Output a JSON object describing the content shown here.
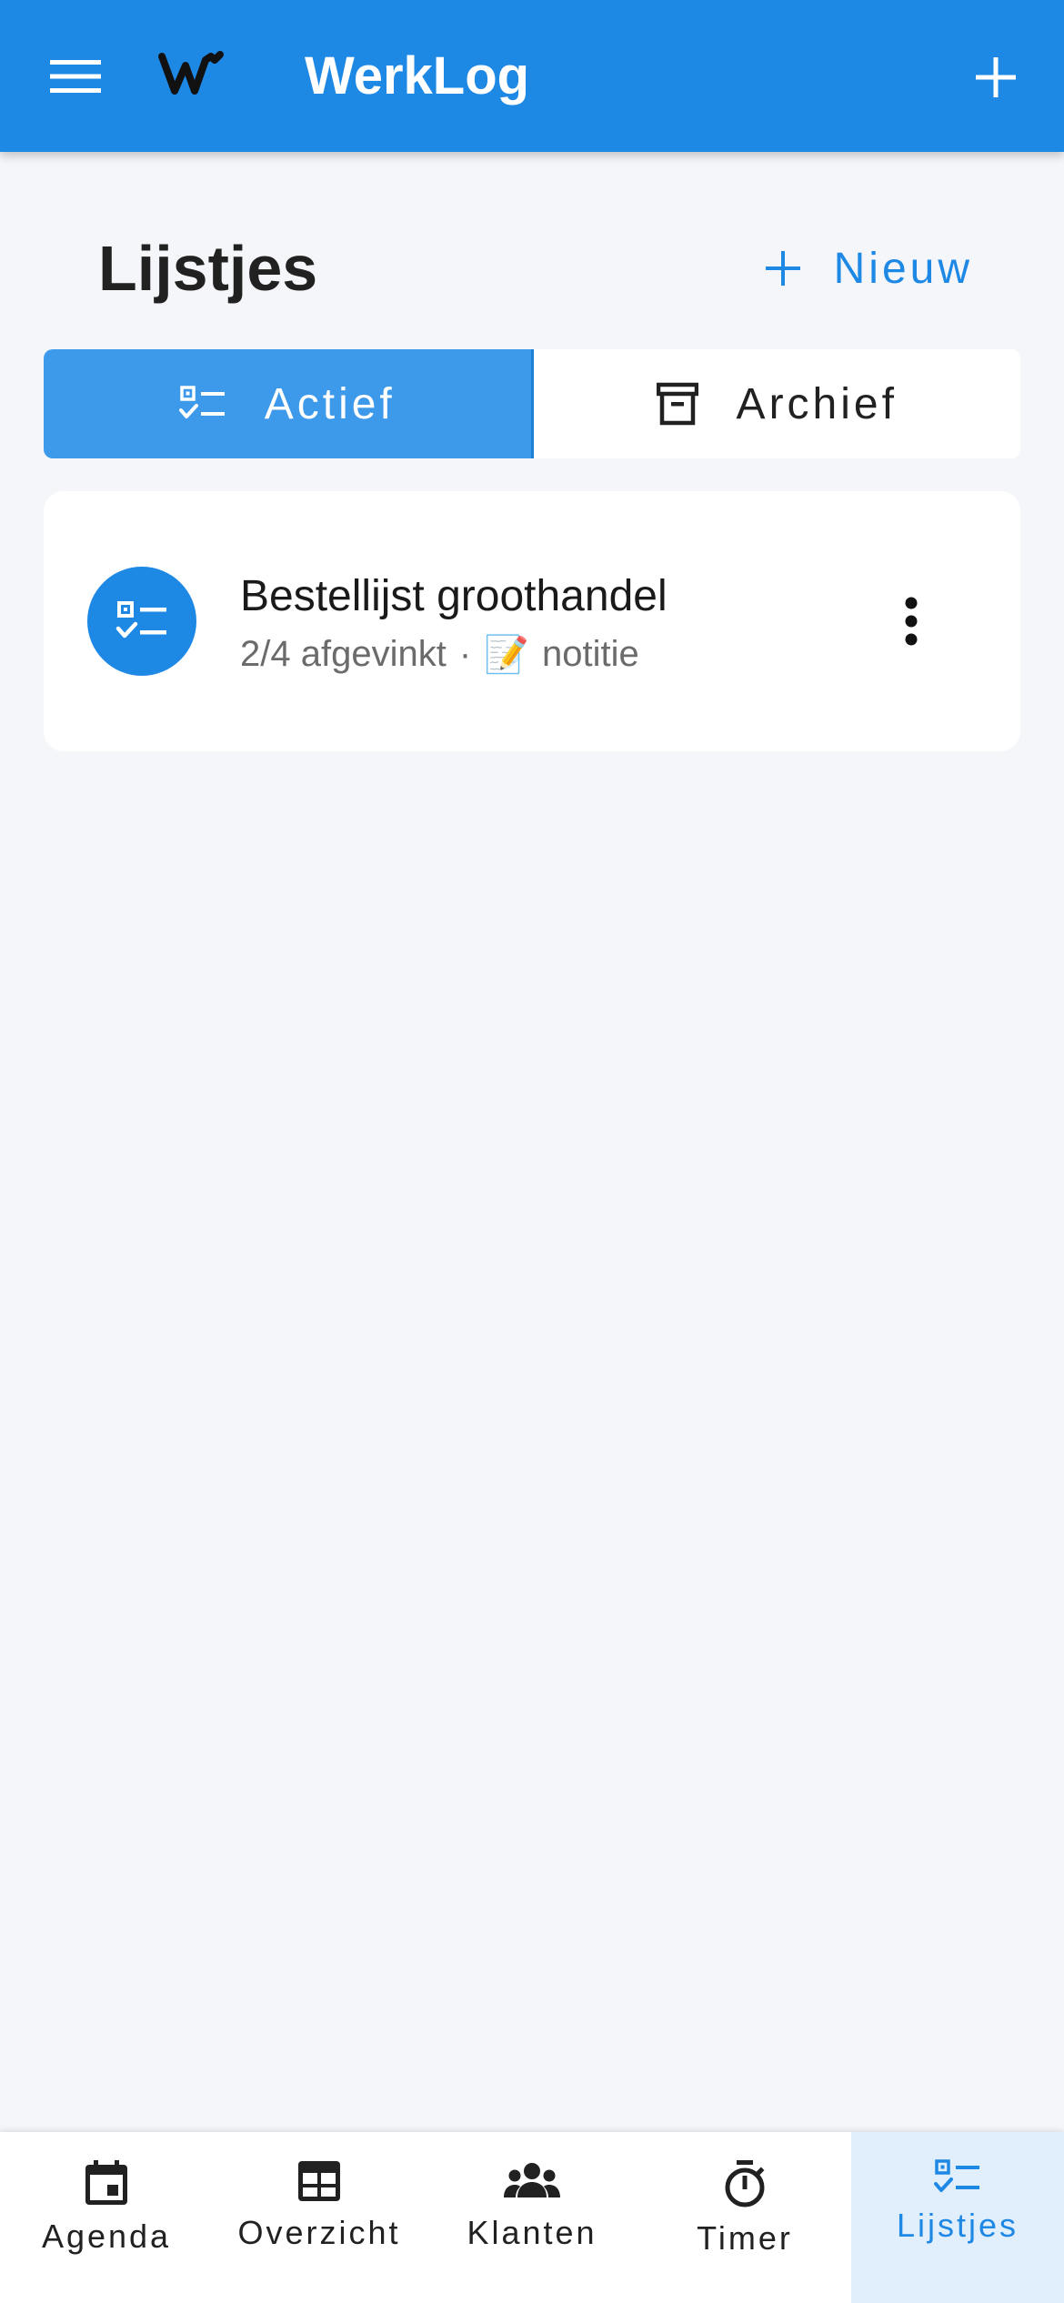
{
  "app": {
    "title": "WerkLog",
    "accent_color": "#1e88e5"
  },
  "header": {
    "page_title": "Lijstjes",
    "new_label": "Nieuw"
  },
  "tabs": [
    {
      "label": "Actief",
      "icon": "checklist-icon",
      "active": true
    },
    {
      "label": "Archief",
      "icon": "archive-icon",
      "active": false
    }
  ],
  "lists": [
    {
      "title": "Bestellijst groothandel",
      "progress": "2/4 afgevinkt",
      "separator": "·",
      "note_emoji": "📝",
      "note_label": "notitie"
    }
  ],
  "bottom_nav": [
    {
      "label": "Agenda",
      "icon": "calendar-icon",
      "active": false
    },
    {
      "label": "Overzicht",
      "icon": "grid-icon",
      "active": false
    },
    {
      "label": "Klanten",
      "icon": "people-icon",
      "active": false
    },
    {
      "label": "Timer",
      "icon": "stopwatch-icon",
      "active": false
    },
    {
      "label": "Lijstjes",
      "icon": "checklist-icon",
      "active": true
    }
  ]
}
